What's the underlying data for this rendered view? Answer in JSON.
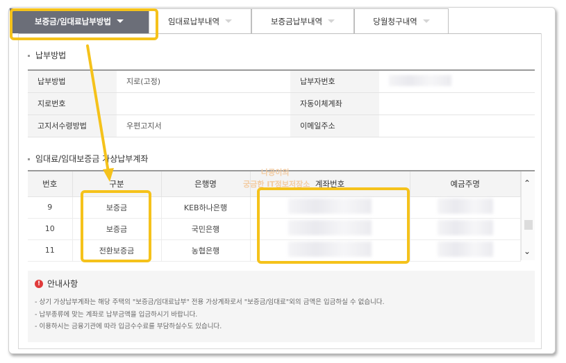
{
  "tabs": [
    {
      "label": "보증금/임대료납부방법",
      "active": true
    },
    {
      "label": "임대료납부내역",
      "active": false
    },
    {
      "label": "보증금납부내역",
      "active": false
    },
    {
      "label": "당월청구내역",
      "active": false
    }
  ],
  "payment_section": {
    "title": "납부방법",
    "rows": [
      {
        "label1": "납부방법",
        "value1": "지로(고정)",
        "label2": "납부자번호",
        "value2": ""
      },
      {
        "label1": "지로번호",
        "value1": "",
        "label2": "자동이체계좌",
        "value2": ""
      },
      {
        "label1": "고지서수령방법",
        "value1": "우편고지서",
        "label2": "이메일주소",
        "value2": ""
      }
    ]
  },
  "account_section": {
    "title": "임대료/임대보증금 가상납부계좌",
    "headers": [
      "번호",
      "구분",
      "은행명",
      "계좌번호",
      "예금주명"
    ],
    "rows": [
      {
        "no": "9",
        "type": "보증금",
        "bank": "KEB하나은행"
      },
      {
        "no": "10",
        "type": "보증금",
        "bank": "국민은행"
      },
      {
        "no": "11",
        "type": "전환보증금",
        "bank": "농협은행"
      }
    ]
  },
  "notice": {
    "title": "안내사항",
    "items": [
      "- 상기 가상납부계좌는 해당 주택의 \"보증금/임대료납부\" 전용 가상계좌로서 \"보증금/임대료\"외의 금액은 입금하실 수 없습니다.",
      "- 납부종류에 맞는 계좌로 납부금액을 입금하시기 바랍니다.",
      "- 이용하시는 금융기관에 따라 입금수수료를 부담하실수도 있습니다."
    ]
  },
  "watermark": {
    "line1": "나공이의",
    "line2": "궁금한 IT정보저장소"
  },
  "colors": {
    "active_tab": "#6b6e78",
    "highlight": "#f5c21b",
    "warning": "#e03a3a"
  }
}
